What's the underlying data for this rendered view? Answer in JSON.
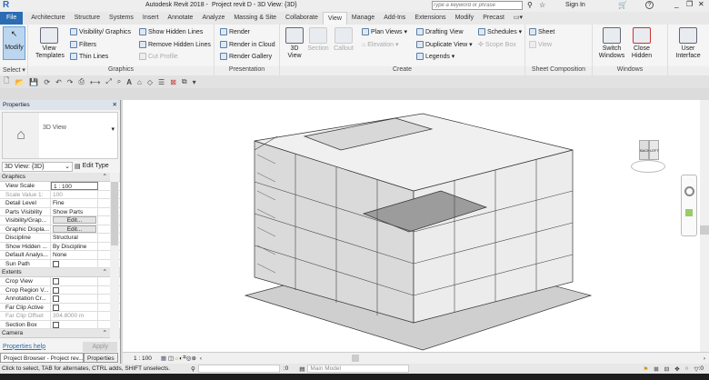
{
  "app": {
    "title": "Autodesk Revit 2018 -",
    "doc": "Project revit D - 3D View: {3D}",
    "search_placeholder": "Type a keyword or phrase",
    "sign_in": "Sign In",
    "help": "?"
  },
  "tabs": [
    "File",
    "Architecture",
    "Structure",
    "Systems",
    "Insert",
    "Annotate",
    "Analyze",
    "Massing & Site",
    "Collaborate",
    "View",
    "Manage",
    "Add-Ins",
    "Extensions",
    "Modify",
    "Precast"
  ],
  "ribbon": {
    "select": {
      "modify": "Modify",
      "label": "Select ▾"
    },
    "graphics": {
      "view_templates": "View Templates",
      "visibility": "Visibility/ Graphics",
      "filters": "Filters",
      "thin_lines": "Thin Lines",
      "show_hidden": "Show Hidden Lines",
      "remove_hidden": "Remove Hidden Lines",
      "cut_profile": "Cut Profile",
      "label": "Graphics"
    },
    "presentation": {
      "render": "Render",
      "render_cloud": "Render in Cloud",
      "render_gallery": "Render Gallery",
      "label": "Presentation"
    },
    "create": {
      "view3d": "3D View",
      "section": "Section",
      "callout": "Callout",
      "plan_views": "Plan Views ▾",
      "elevation": "Elevation ▾",
      "drafting": "Drafting View",
      "duplicate": "Duplicate View ▾",
      "legends": "Legends ▾",
      "schedules": "Schedules ▾",
      "scope_box": "Scope Box",
      "label": "Create"
    },
    "sheet": {
      "sheet": "Sheet",
      "view": "View",
      "label": "Sheet Composition"
    },
    "windows": {
      "switch": "Switch Windows",
      "close_hidden": "Close Hidden",
      "label": "Windows"
    },
    "ui": {
      "user_interface": "User Interface"
    }
  },
  "properties": {
    "title": "Properties",
    "type": "3D View",
    "selector": "3D View: {3D}",
    "edit_type": "Edit Type",
    "groups": {
      "graphics": "Graphics",
      "extents": "Extents",
      "camera": "Camera"
    },
    "graphics_rows": [
      {
        "k": "View Scale",
        "v": "1 : 100"
      },
      {
        "k": "Scale Value    1:",
        "v": "100"
      },
      {
        "k": "Detail Level",
        "v": "Fine"
      },
      {
        "k": "Parts Visibility",
        "v": "Show Parts"
      },
      {
        "k": "Visibility/Grap...",
        "v": "Edit..."
      },
      {
        "k": "Graphic Displa...",
        "v": "Edit..."
      },
      {
        "k": "Discipline",
        "v": "Structural"
      },
      {
        "k": "Show Hidden ...",
        "v": "By Discipline"
      },
      {
        "k": "Default Analys...",
        "v": "None"
      },
      {
        "k": "Sun Path",
        "v": ""
      }
    ],
    "extents_rows": [
      {
        "k": "Crop View",
        "v": ""
      },
      {
        "k": "Crop Region V...",
        "v": ""
      },
      {
        "k": "Annotation Cr...",
        "v": ""
      },
      {
        "k": "Far Clip Active",
        "v": ""
      },
      {
        "k": "Far Clip Offset",
        "v": "304.8000 m"
      },
      {
        "k": "Section Box",
        "v": ""
      }
    ],
    "help": "Properties help",
    "apply": "Apply",
    "bottom_tabs": [
      "Project Browser - Project rev...",
      "Properties"
    ]
  },
  "viewcube": {
    "back": "BACK",
    "left": "LEFT"
  },
  "view_control": {
    "scale": "1 : 100"
  },
  "status": {
    "hint": "Click to select, TAB for alternates, CTRL adds, SHIFT unselects.",
    "count": ":0",
    "model": "Main Model",
    "filter": ":0"
  }
}
